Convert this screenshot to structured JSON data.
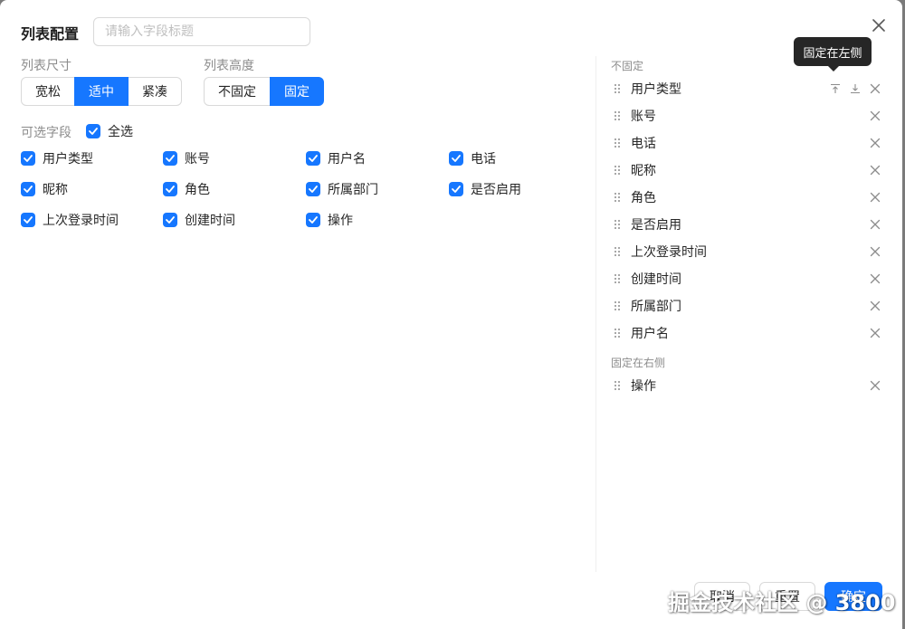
{
  "dialog": {
    "title": "列表配置",
    "search_placeholder": "请输入字段标题"
  },
  "size": {
    "label": "列表尺寸",
    "options": [
      "宽松",
      "适中",
      "紧凑"
    ],
    "selected": "适中"
  },
  "height": {
    "label": "列表高度",
    "options": [
      "不固定",
      "固定"
    ],
    "selected": "固定"
  },
  "fields": {
    "label": "可选字段",
    "select_all": "全选",
    "items": [
      "用户类型",
      "账号",
      "用户名",
      "电话",
      "昵称",
      "角色",
      "所属部门",
      "是否启用",
      "上次登录时间",
      "创建时间",
      "操作"
    ]
  },
  "right": {
    "unfixed_title": "不固定",
    "unfixed": [
      "用户类型",
      "账号",
      "电话",
      "昵称",
      "角色",
      "是否启用",
      "上次登录时间",
      "创建时间",
      "所属部门",
      "用户名"
    ],
    "fixed_right_title": "固定在右侧",
    "fixed_right": [
      "操作"
    ],
    "tooltip": "固定在左侧"
  },
  "footer": {
    "buttons": [
      "取消",
      "重置",
      "确定"
    ]
  },
  "watermark": "掘金技术社区 @ 3800",
  "colors": {
    "primary": "#1677ff"
  }
}
